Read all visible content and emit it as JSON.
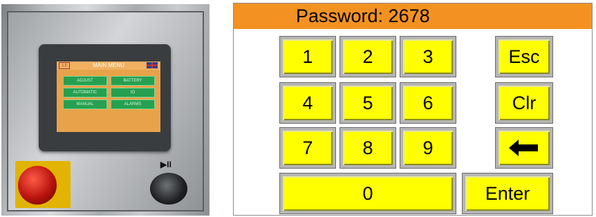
{
  "photo": {
    "main_menu": {
      "version": "1.0",
      "title": "MAIN MENU",
      "buttons": [
        "ADJUST",
        "BATTERY",
        "AUTOMATIC",
        "IO",
        "MANUAL",
        "ALARMS"
      ]
    },
    "knob_symbol": "▶II"
  },
  "keypad": {
    "password_label": "Password: 2678",
    "keys": {
      "k1": "1",
      "k2": "2",
      "k3": "3",
      "k4": "4",
      "k5": "5",
      "k6": "6",
      "k7": "7",
      "k8": "8",
      "k9": "9",
      "k0": "0",
      "esc": "Esc",
      "clr": "Clr",
      "enter": "Enter"
    },
    "backspace_icon": "left-arrow-icon"
  },
  "colors": {
    "title_bar": "#f39222",
    "key": "#ffff00"
  }
}
